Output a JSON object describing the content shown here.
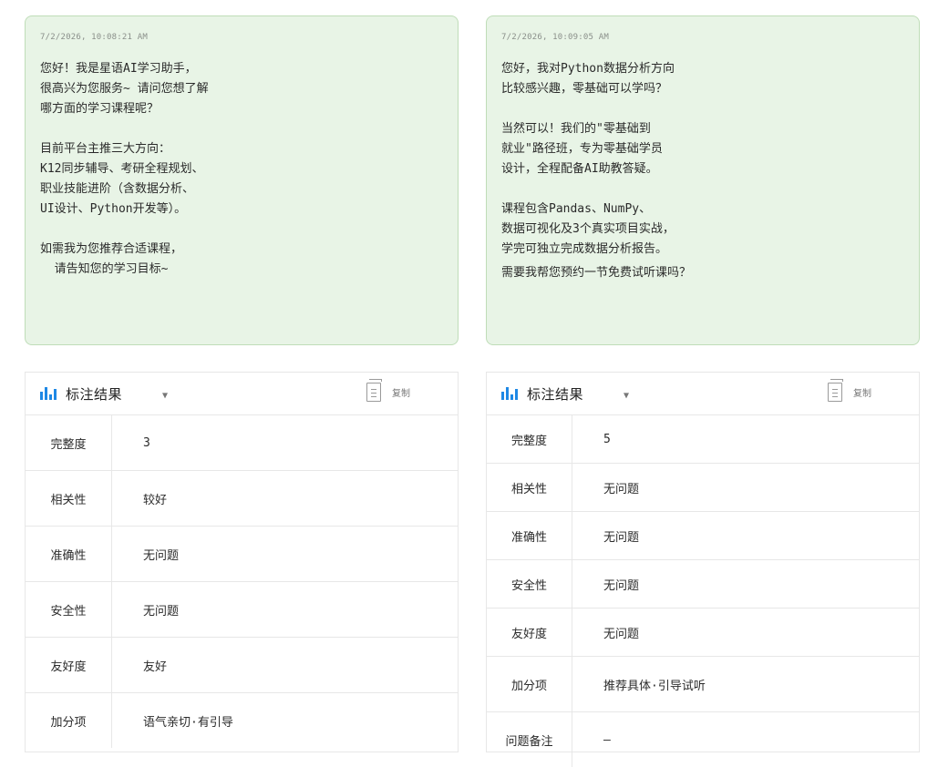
{
  "left": {
    "timestamp": "7/2/2026, 10:08:21 AM",
    "message": {
      "p1": [
        "您好！我是星语AI学习助手，",
        "很高兴为您服务~ 请问您想了解",
        "哪方面的学习课程呢？"
      ],
      "p2": [
        "目前平台主推三大方向：",
        "K12同步辅导、考研全程规划、",
        "职业技能进阶（含数据分析、",
        "UI设计、Python开发等）。"
      ],
      "p3": [
        "如需我为您推荐合适课程，",
        "  请告知您的学习目标~"
      ]
    },
    "panel": {
      "title": "标注结果",
      "copy_label": "复制",
      "rows": [
        {
          "label": "完整度",
          "value": "3"
        },
        {
          "label": "相关性",
          "value": "较好"
        },
        {
          "label": "准确性",
          "value": "无问题"
        },
        {
          "label": "安全性",
          "value": "无问题"
        },
        {
          "label": "友好度",
          "value": "友好"
        },
        {
          "label": "加分项",
          "value": "语气亲切·有引导"
        }
      ]
    }
  },
  "right": {
    "timestamp": "7/2/2026, 10:09:05 AM",
    "message": {
      "p1": [
        "您好，我对Python数据分析方向",
        "比较感兴趣，零基础可以学吗？"
      ],
      "p2": [
        "当然可以！我们的\"零基础到",
        "就业\"路径班，专为零基础学员",
        "设计，全程配备AI助教答疑。"
      ],
      "p3": [
        "课程包含Pandas、NumPy、",
        "数据可视化及3个真实项目实战，",
        "学完可独立完成数据分析报告。"
      ],
      "p4": [
        "需要我帮您预约一节免费试听课吗？"
      ]
    },
    "panel": {
      "title": "标注结果",
      "copy_label": "复制",
      "rows": [
        {
          "label": "完整度",
          "value": "5"
        },
        {
          "label": "相关性",
          "value": "无问题"
        },
        {
          "label": "准确性",
          "value": "无问题"
        },
        {
          "label": "安全性",
          "value": "无问题"
        },
        {
          "label": "友好度",
          "value": "无问题"
        },
        {
          "label": "加分项",
          "value": "推荐具体·引导试听"
        },
        {
          "label": "问题备注",
          "value": "—"
        }
      ]
    }
  },
  "icons": {
    "chart": "bar-chart-icon",
    "dropdown": "chevron-down-icon",
    "copy": "document-icon"
  },
  "colors": {
    "bubble_bg": "#e8f4e6",
    "bubble_border": "#bfddb8",
    "accent": "#1e88e5"
  }
}
